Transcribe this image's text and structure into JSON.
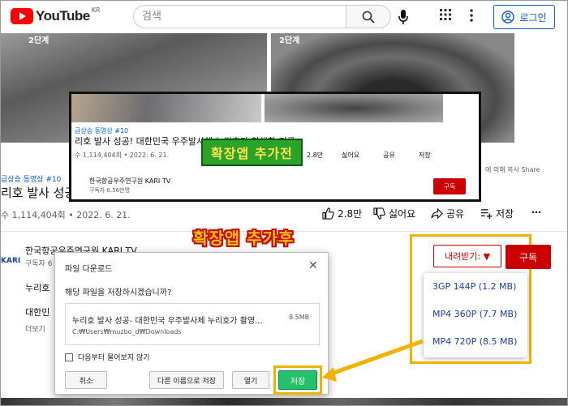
{
  "header": {
    "logo_text": "YouTube",
    "region": "KR",
    "search_placeholder": "검색",
    "login_label": "로그인"
  },
  "thumbs": {
    "left_label": "2단계",
    "right_label": "2단계"
  },
  "video": {
    "tag": "급상승 동영상 #10",
    "title": "리호 발사 성공",
    "views": "수 1,114,404회 • 2022. 6. 21.",
    "likes": "2.8만",
    "dislike_label": "싫어요",
    "share_label": "공유",
    "save_label": "저장",
    "more_label": "⋯"
  },
  "channel": {
    "name": "한국항공우주연구원 KARI TV",
    "subs": "구독자 6",
    "logo": "KARI"
  },
  "behind_text": {
    "line1": "누리호",
    "line2": "대한민",
    "line3": "더보기"
  },
  "inset": {
    "tag": "급상승 동영상 #10",
    "title": "리호 발사 성공! 대한민국 우주발사체 누리호가 향해한 지구",
    "views": "수 1,114,404회 • 2022. 6. 21.",
    "likes": "2.8만",
    "dislike_label": "싫어요",
    "share_label": "공유",
    "save_label": "저장",
    "channel_name": "한국항공우주연구원 KARI TV",
    "channel_subs": "구독자 6.56만명",
    "subscribe_label": "구독",
    "badge": "확장앱 추가전",
    "side_text": "에 의해 복사 Share"
  },
  "after_badge": "확장앱 추가후",
  "download": {
    "button_label": "내려받기: ▼",
    "subscribe_label": "구독",
    "options": [
      "3GP 144P (1.2 MB)",
      "MP4 360P (7.7 MB)",
      "MP4 720P (8.5 MB)"
    ]
  },
  "dialog": {
    "title": "파일 다운로드",
    "close": "✕",
    "question": "해당 파일을 저장하시겠습니까?",
    "file_name": "누리호 발사 성공- 대한민국 우주발사체 누리호가 촬영...",
    "file_size": "8.5MB",
    "file_path": "C:₩Users₩muzbo_d₩Downloads",
    "checkbox_label": "다음부터 물어보지 않기",
    "cancel_label": "취소",
    "save_as_label": "다른 이름으로 저장",
    "open_label": "열기",
    "save_label": "저장"
  },
  "colors": {
    "youtube_red": "#ff0000",
    "subscribe_red": "#cc0000",
    "highlight_yellow": "#f2b300",
    "badge_green": "#2ba32b",
    "save_green": "#25c06a",
    "link_blue": "#065fd4"
  }
}
